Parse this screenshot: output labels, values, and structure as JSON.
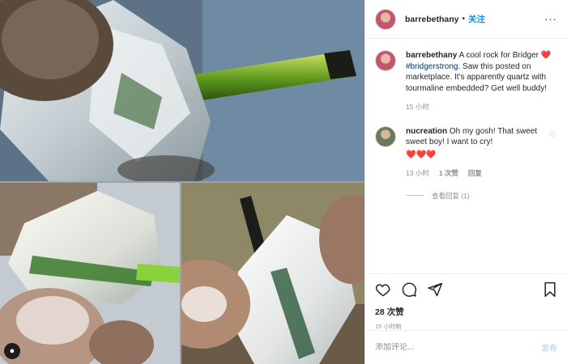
{
  "header": {
    "username": "barrebethany",
    "dot": "•",
    "follow_label": "关注",
    "more_label": "···"
  },
  "caption": {
    "username": "barrebethany",
    "text_before": "A cool rock for Bridger",
    "heart": "❤️",
    "hashtag": "#bridgerstrong",
    "text_after": ". Saw this posted on marketplace. It's apparently quartz with tourmaline embedded? Get well buddy!",
    "time": "15 小时"
  },
  "comment": {
    "username": "nucreation",
    "text": "Oh my gosh! That sweet sweet boy! I want to cry!",
    "hearts": "❤️❤️❤️",
    "time": "13 小时",
    "likes": "1 次赞",
    "reply_label": "回复",
    "view_replies": "查看回复 (1)"
  },
  "actions": {
    "likes_count": "28 次赞",
    "date": "15 小时前"
  },
  "comment_input": {
    "placeholder": "添加评论...",
    "post_label": "发布"
  },
  "icons": {
    "like": "heart-outline-icon",
    "comment": "speech-bubble-icon",
    "share": "paper-plane-icon",
    "save": "bookmark-icon",
    "tag": "person-tag-icon"
  },
  "colors": {
    "link_blue": "#0095f6",
    "hashtag": "#00376b",
    "heart_red": "#ed4956",
    "muted": "#8e8e8e",
    "post_disabled": "#b2dffc"
  }
}
